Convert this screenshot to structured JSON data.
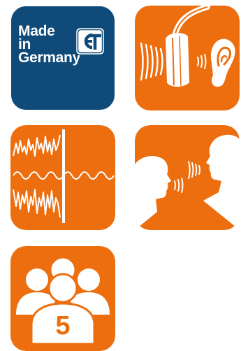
{
  "colors": {
    "orange": "#ec6e0f",
    "navy": "#0f4a78",
    "white": "#ffffff"
  },
  "badge": {
    "line1": "Made",
    "line2": "in",
    "line3": "Germany"
  },
  "group": {
    "count": "5"
  },
  "icons": [
    "made-in-germany-badge",
    "gt-logo-icon",
    "headphone-speaker-ear-icon",
    "sound-wave-filter-icon",
    "two-people-talking-icon",
    "user-group-icon"
  ]
}
